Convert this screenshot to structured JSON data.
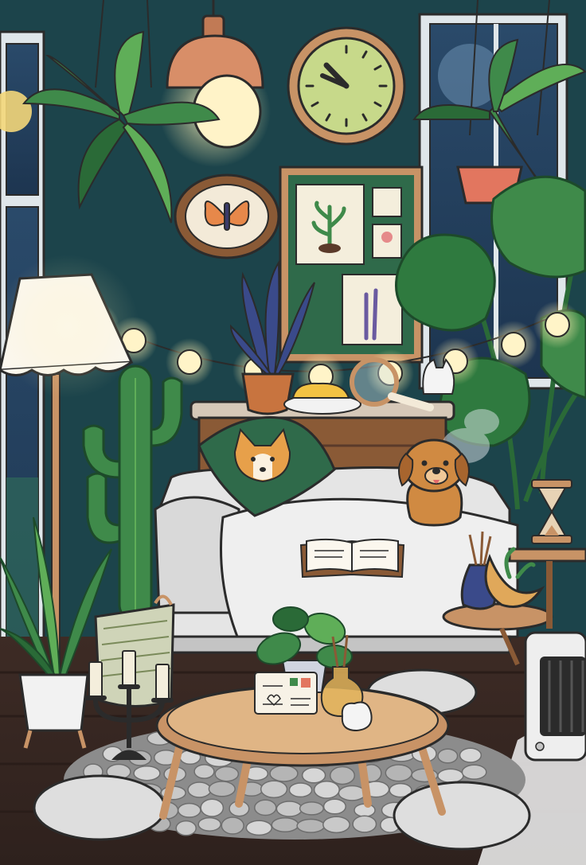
{
  "scene": {
    "title": "",
    "style": "cozy illustrated room (Toca Boca style)",
    "palette": {
      "wall": "#1f4a52",
      "wall_shadow": "#163940",
      "floor": "#3b2a25",
      "floor_line": "#2a1d19",
      "wood": "#c8915c",
      "wood_dark": "#8a5a36",
      "leaf": "#3f8a4a",
      "leaf_light": "#5fae58",
      "leaf_dark": "#2a6a37",
      "sofa": "#e5e5e5",
      "sofa_shadow": "#c4c4c4",
      "glow": "#fff4c8",
      "outline": "#2b2b2b"
    }
  },
  "objects": {
    "wall_clock": {
      "icon": "clock-icon"
    },
    "pendant_lamp": {
      "icon": "pendant-lamp-icon"
    },
    "butterfly_frame": {
      "icon": "butterfly-icon"
    },
    "botanical_board": {
      "icon": "plant-prints-board-icon"
    },
    "floor_lamp": {
      "icon": "floor-lamp-icon"
    },
    "string_lights": {
      "bulb_count": 9
    },
    "corgi_cushion": {
      "icon": "corgi-pillow-icon"
    },
    "puppy_plush": {
      "icon": "dog-plush-icon"
    },
    "open_book": {
      "icon": "book-icon"
    },
    "hourglass": {
      "icon": "hourglass-icon"
    },
    "heater": {
      "icon": "heater-icon"
    },
    "postcard": {
      "icon": "postcard-icon"
    },
    "candelabra": {
      "icon": "candles-icon",
      "candles": 3
    },
    "coffee_table": {
      "icon": "round-table-icon"
    },
    "cat_figurine": {
      "icon": "cat-icon"
    },
    "magnifier": {
      "icon": "magnifying-glass-icon"
    },
    "cactus": {
      "icon": "cactus-icon"
    },
    "monstera": {
      "icon": "monstera-icon"
    },
    "fern": {
      "icon": "fern-icon"
    },
    "snake_plant": {
      "icon": "snake-plant-icon"
    }
  }
}
